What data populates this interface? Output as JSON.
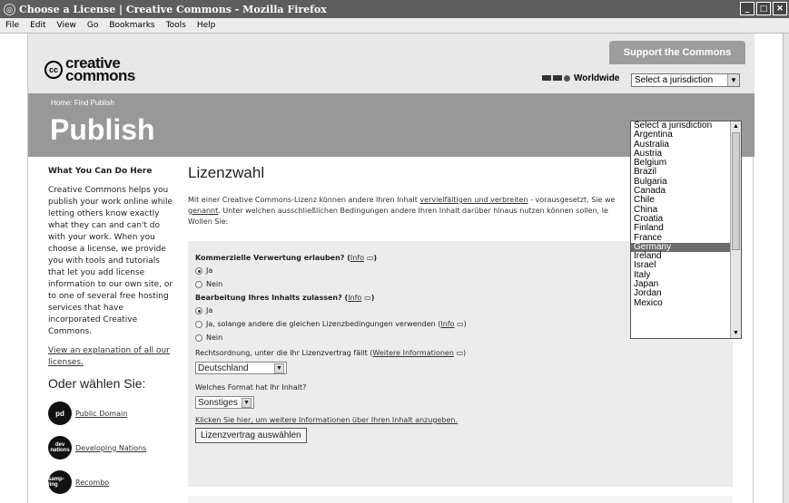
{
  "window": {
    "title": "Choose a License | Creative Commons - Mozilla Firefox"
  },
  "menu": [
    "File",
    "Edit",
    "View",
    "Go",
    "Bookmarks",
    "Tools",
    "Help"
  ],
  "header": {
    "support": "Support the Commons",
    "logo_top": "creative",
    "logo_bottom": "commons",
    "worldwide": "Worldwide",
    "jurisdiction_selected": "Select a jurisdiction"
  },
  "banner": {
    "crumb": "Home: Find  Publish",
    "title": "Publish"
  },
  "sidebar": {
    "heading": "What You Can Do Here",
    "body": "Creative Commons helps you publish your work online while letting others know exactly what they can and can't do with your work. When you choose a license, we provide you with tools and tutorials that let you add license information to our own site, or to one of several free hosting services that have incorporated Creative Commons.",
    "explain_link": "View an explanation of all our licenses.",
    "oder": "Oder wählen Sie:",
    "options": [
      {
        "badge": "pd",
        "label": "Public Domain"
      },
      {
        "badge": "dev nations",
        "label": "Developing Nations"
      },
      {
        "badge": "samp-ling",
        "label": "Recombo"
      }
    ]
  },
  "main": {
    "title": "Lizenzwahl",
    "intro_a": "Mit einer Creative Commons-Lizenz können andere Ihren Inhalt ",
    "intro_link1": "vervielfältigen und verbreiten",
    "intro_b": " - vorausgesetzt, Sie we",
    "intro_link2": "genannt",
    "intro_c": ". Unter welchen ausschließlichen Bedingungen andere Ihren Inhalt darüber hinaus nutzen können sollen, le",
    "intro_d": "Wollen Sie:"
  },
  "form": {
    "q1": "Kommerzielle Verwertung erlauben?",
    "info": "Info",
    "q1_yes": "Ja",
    "q1_no": "Nein",
    "q2": "Bearbeitung Ihres Inhalts zulassen?",
    "q2_yes": "Ja",
    "q2_sa": "Ja, solange andere die gleichen Lizenzbedingungen verwenden (",
    "q2_no": "Nein",
    "juris_label": "Rechtsordnung, unter die Ihr Lizenzvertrag fällt (",
    "juris_more": "Weitere Informationen",
    "juris_value": "Deutschland",
    "format_label": "Welches Format hat Ihr Inhalt?",
    "format_value": "Sonstiges",
    "more_link": "Klicken Sie hier, um weitere Informationen über Ihren Inhalt anzugeben.",
    "submit": "Lizenzvertrag auswählen"
  },
  "dropdown": {
    "items": [
      "Select a jurisdiction",
      "Argentina",
      "Australia",
      "Austria",
      "Belgium",
      "Brazil",
      "Bulgaria",
      "Canada",
      "Chile",
      "China",
      "Croatia",
      "Finland",
      "France",
      "Germany",
      "Ireland",
      "Israel",
      "Italy",
      "Japan",
      "Jordan",
      "Mexico"
    ],
    "highlighted": "Germany"
  }
}
